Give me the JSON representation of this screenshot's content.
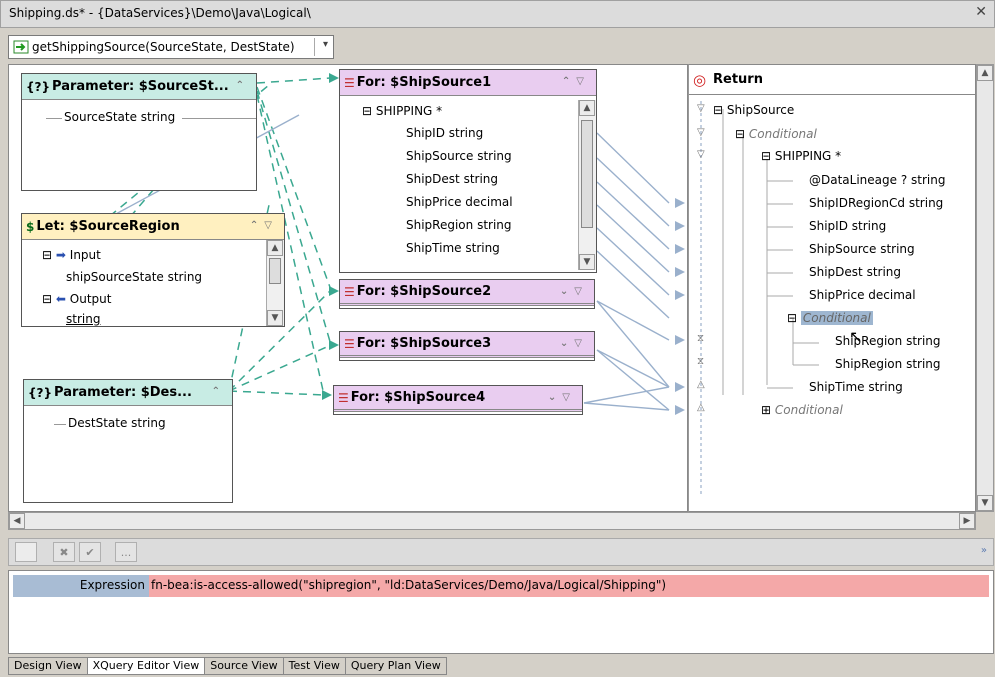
{
  "window": {
    "title": "Shipping.ds* - {DataServices}\\Demo\\Java\\Logical\\",
    "close_label": "✕"
  },
  "function_selector": {
    "value": "getShippingSource(SourceState, DestState)",
    "arrow": "▾"
  },
  "nodes": {
    "param_source": {
      "icon": "{?}",
      "title": "Parameter: $SourceSt...",
      "fields": [
        "SourceState string"
      ]
    },
    "let_region": {
      "icon": "$",
      "title": "Let: $SourceRegion",
      "input_label": "Input",
      "input_field": "shipSourceState string",
      "output_label": "Output",
      "output_field": "string"
    },
    "param_dest": {
      "icon": "{?}",
      "title": "Parameter: $Des...",
      "fields": [
        "DestState string"
      ]
    },
    "for1": {
      "title": "For: $ShipSource1",
      "group": "SHIPPING *",
      "fields": [
        "ShipID string",
        "ShipSource string",
        "ShipDest string",
        "ShipPrice decimal",
        "ShipRegion string",
        "ShipTime string"
      ]
    },
    "for2": {
      "title": "For: $ShipSource2"
    },
    "for3": {
      "title": "For: $ShipSource3"
    },
    "for4": {
      "title": "For: $ShipSource4"
    }
  },
  "return_tree": {
    "title": "Return",
    "root": "ShipSource",
    "conditional": "Conditional",
    "group": "SHIPPING *",
    "fields": [
      "@DataLineage ? string",
      "ShipIDRegionCd string",
      "ShipID string",
      "ShipSource string",
      "ShipDest string",
      "ShipPrice decimal"
    ],
    "inner_conditional": "Conditional",
    "inner_fields": [
      "ShipRegion string",
      "ShipRegion string"
    ],
    "ship_time": "ShipTime string",
    "conditional_bottom": "Conditional"
  },
  "expression": {
    "label": "Expression",
    "value": "fn-bea:is-access-allowed(\"shipregion\", \"ld:DataServices/Demo/Java/Logical/Shipping\")"
  },
  "bottom_toolbar": {
    "more_label": "..."
  },
  "tabs": [
    "Design View",
    "XQuery Editor View",
    "Source View",
    "Test View",
    "Query Plan View"
  ],
  "colors": {
    "param_header": "#c8ece4",
    "let_header": "#fff0c0",
    "for_header": "#e9cdf0",
    "link_dashed": "#3aa890",
    "link_solid": "#9ab0cc",
    "expression_value_bg": "#f4a8a8"
  }
}
